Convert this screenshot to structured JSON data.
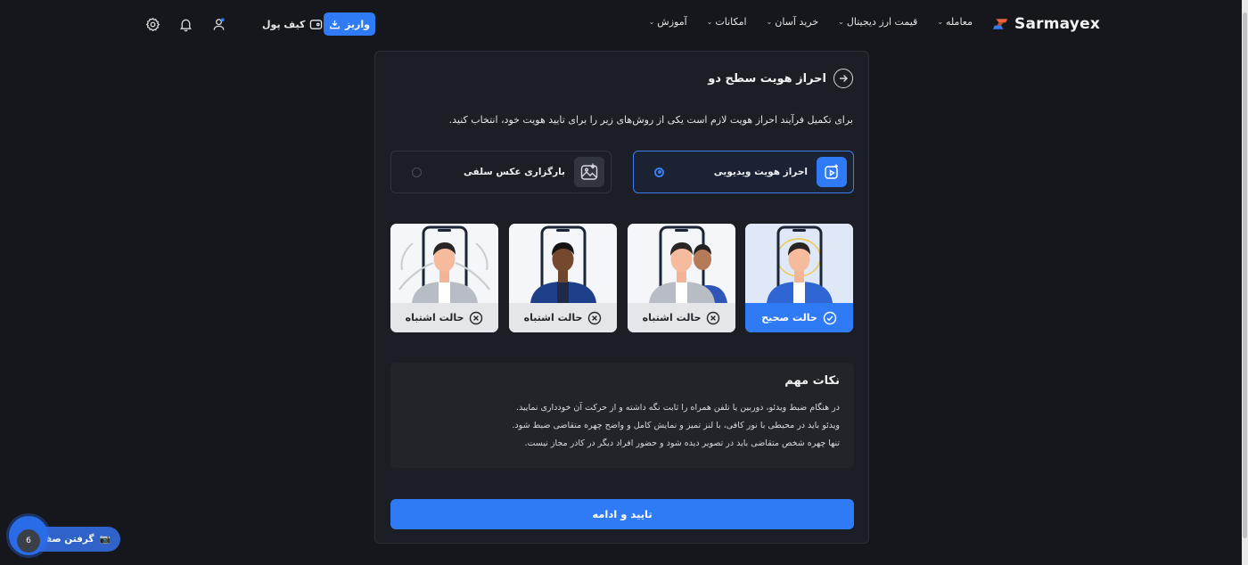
{
  "header": {
    "brand": "Sarmayex",
    "nav": [
      {
        "label": "معامله"
      },
      {
        "label": "قیمت ارز دیجیتال"
      },
      {
        "label": "خرید آسان"
      },
      {
        "label": "امکانات"
      },
      {
        "label": "آموزش"
      }
    ],
    "deposit_label": "واریز",
    "wallet_label": "کیف پول",
    "icons": [
      "user-icon",
      "bell-icon",
      "gear-icon"
    ]
  },
  "page": {
    "title": "احراز هویت سطح دو",
    "intro": "برای تکمیل فرآیند احراز هویت لازم است یکی از روش‌های زیر را برای تایید هویت خود، انتخاب کنید.",
    "options": [
      {
        "label": "احراز هویت ویدیویی",
        "selected": true,
        "icon": "video-plus-icon"
      },
      {
        "label": "بارگزاری عکس سلفی",
        "selected": false,
        "icon": "image-download-icon"
      }
    ],
    "examples": [
      {
        "label": "حالت صحیح",
        "status": "correct"
      },
      {
        "label": "حالت اشتباه",
        "status": "wrong"
      },
      {
        "label": "حالت اشتباه",
        "status": "wrong"
      },
      {
        "label": "حالت اشتباه",
        "status": "wrong"
      }
    ],
    "tips": {
      "title": "نکات مهم",
      "lines": [
        "در هنگام ضبط ویدئو، دوربین یا تلفن همراه را ثابت نگه داشته و از حرکت آن خودداری نمایید.",
        "ویدئو باید در محیطی با نور کافی، با لنز تمیز و نمایش کامل و واضح چهره متقاضی ضبط شود.",
        "تنها چهره شخص متقاضی باید در تصویر دیده شود و حضور افراد دیگر در کادر مجاز نیست."
      ]
    },
    "confirm_label": "تایید و ادامه"
  },
  "support": {
    "label": "گرفتن صفحه",
    "count": "6"
  },
  "colors": {
    "accent": "#2f7bf5",
    "background": "#15171c",
    "card": "#1b1e24"
  }
}
